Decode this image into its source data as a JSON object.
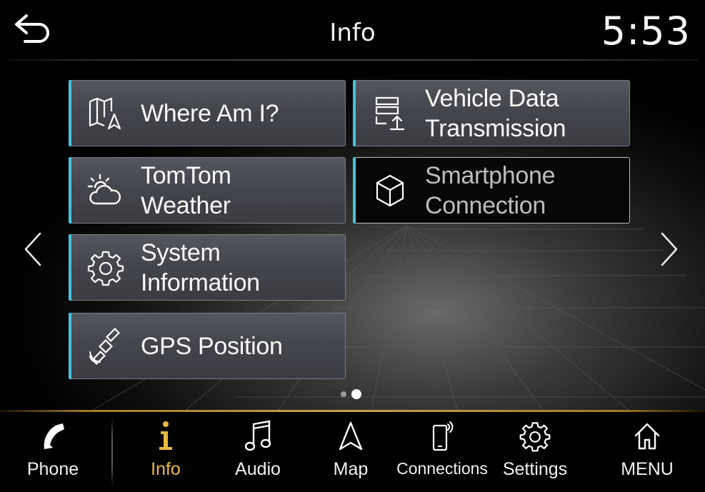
{
  "header": {
    "title": "Info",
    "clock": "5:53",
    "back_icon": "back-arrow-icon"
  },
  "tiles": [
    {
      "icon": "map-location-icon",
      "lines": [
        "Where Am I?"
      ],
      "state": "enabled"
    },
    {
      "icon": "data-upload-icon",
      "lines": [
        "Vehicle Data",
        "Transmission"
      ],
      "state": "enabled"
    },
    {
      "icon": "weather-icon",
      "lines": [
        "TomTom",
        "Weather"
      ],
      "state": "enabled"
    },
    {
      "icon": "cube-icon",
      "lines": [
        "Smartphone",
        "Connection"
      ],
      "state": "disabled"
    },
    {
      "icon": "gear-icon",
      "lines": [
        "System",
        "Information"
      ],
      "state": "enabled"
    },
    {
      "icon": "satellite-icon",
      "lines": [
        "GPS Position"
      ],
      "state": "enabled"
    }
  ],
  "pagination": {
    "current": 2,
    "total": 2
  },
  "nav": {
    "items": [
      {
        "label": "Phone",
        "icon": "phone-icon",
        "active": false
      },
      {
        "label": "Info",
        "icon": "info-icon",
        "active": true
      },
      {
        "label": "Audio",
        "icon": "music-note-icon",
        "active": false
      },
      {
        "label": "Map",
        "icon": "navigation-arrow-icon",
        "active": false
      },
      {
        "label": "Connections",
        "icon": "smartphone-signal-icon",
        "active": false
      },
      {
        "label": "Settings",
        "icon": "gear-icon",
        "active": false
      },
      {
        "label": "MENU",
        "icon": "home-icon",
        "active": false
      }
    ]
  },
  "colors": {
    "accent_cyan": "#47c2dc",
    "active_label": "#e9b940",
    "nav_separator": "#caa050"
  }
}
